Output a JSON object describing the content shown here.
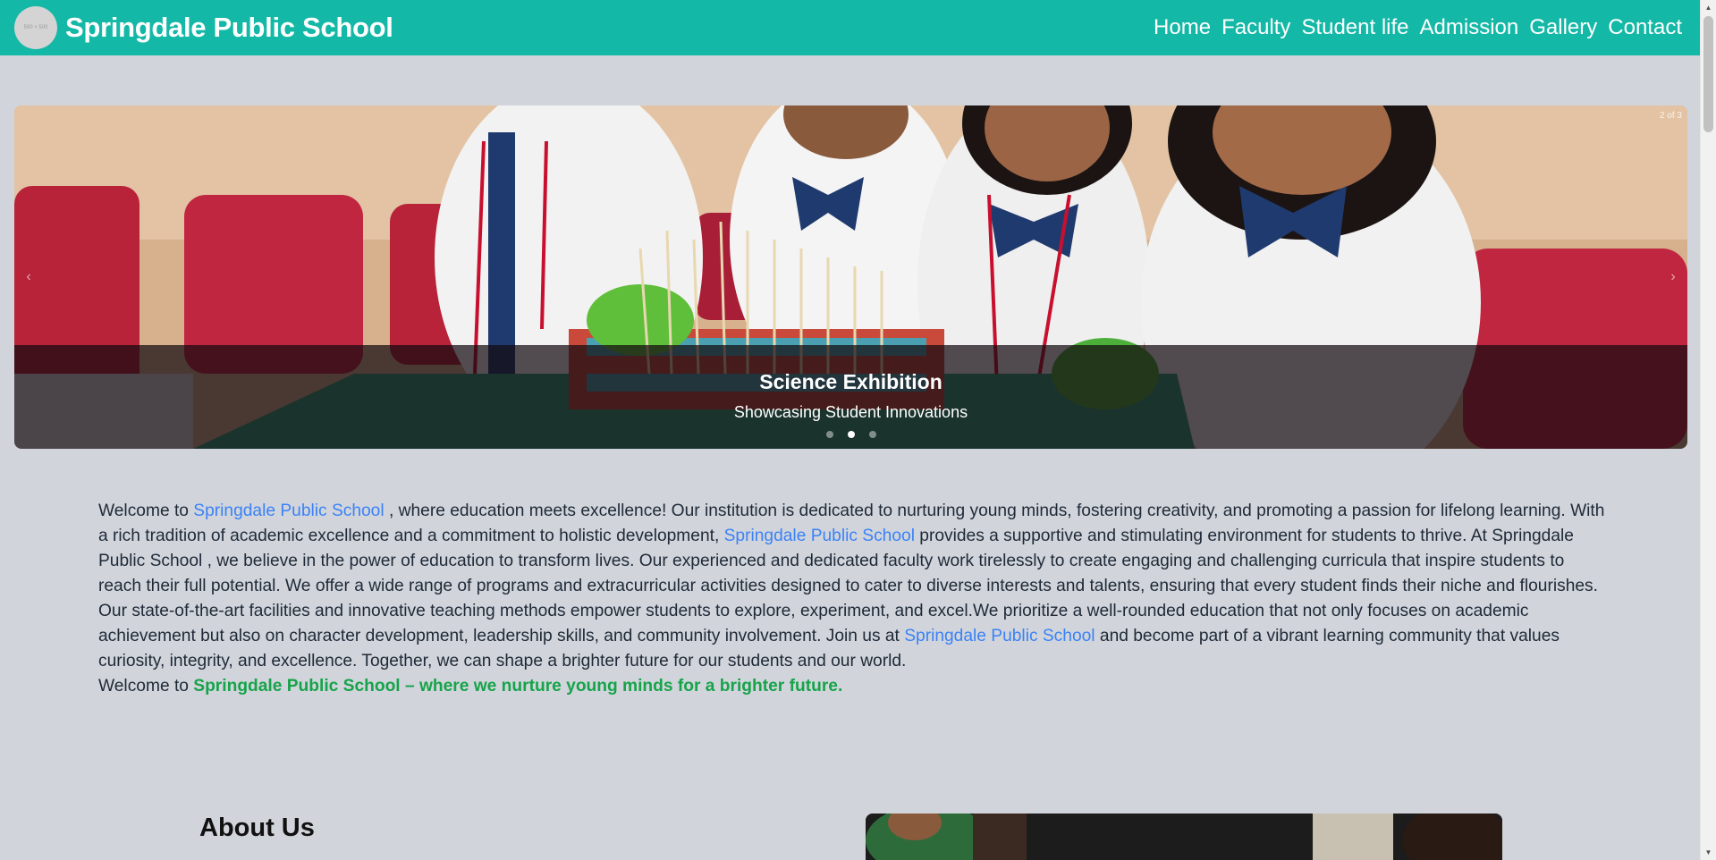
{
  "navbar": {
    "logo_text": "500 × 500",
    "brand": "Springdale Public School",
    "links": [
      "Home",
      "Faculty",
      "Student life",
      "Admission",
      "Gallery",
      "Contact"
    ]
  },
  "carousel": {
    "counter": "2 of 3",
    "caption_title": "Science Exhibition",
    "caption_subtitle": "Showcasing Student Innovations",
    "slide_count": 3,
    "active_slide": 2,
    "prev_arrow": "‹",
    "next_arrow": "›"
  },
  "welcome": {
    "p1_a": "Welcome to ",
    "school_name": "Springdale Public School",
    "p1_b": " , where education meets excellence! Our institution is dedicated to nurturing young minds, fostering creativity, and promoting a passion for lifelong learning. With a rich tradition of academic excellence and a commitment to holistic development, ",
    "p1_c": " provides a supportive and stimulating environment for students to thrive. At Springdale Public School , we believe in the power of education to transform lives. Our experienced and dedicated faculty work tirelessly to create engaging and challenging curricula that inspire students to reach their full potential. We offer a wide range of programs and extracurricular activities designed to cater to diverse interests and talents, ensuring that every student finds their niche and flourishes. Our state-of-the-art facilities and innovative teaching methods empower students to explore, experiment, and excel.We prioritize a well-rounded education that not only focuses on academic achievement but also on character development, leadership skills, and community involvement. Join us at ",
    "p1_d": " and become part of a vibrant learning community that values curiosity, integrity, and excellence. Together, we can shape a brighter future for our students and our world.",
    "p2_a": "Welcome to ",
    "p2_tagline": "Springdale Public School – where we nurture young minds for a brighter future."
  },
  "about": {
    "title": "About Us"
  },
  "colors": {
    "navbar": "#14b8a6",
    "page_bg": "#d1d5db",
    "link_blue": "#3b82f6",
    "tagline_green": "#16a34a"
  }
}
